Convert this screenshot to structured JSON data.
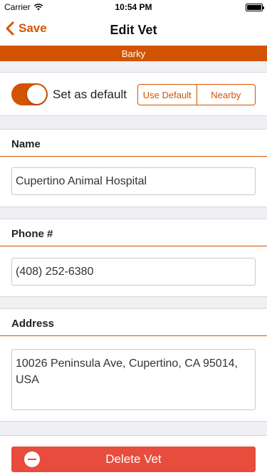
{
  "status_bar": {
    "carrier": "Carrier",
    "time": "10:54 PM"
  },
  "nav": {
    "back_label": "Save",
    "title": "Edit Vet"
  },
  "pet_banner": "Barky",
  "default_row": {
    "label": "Set as default",
    "toggle_on": true,
    "segments": [
      "Use Default",
      "Nearby"
    ]
  },
  "fields": {
    "name": {
      "label": "Name",
      "value": "Cupertino Animal Hospital"
    },
    "phone": {
      "label": "Phone #",
      "value": "(408) 252-6380"
    },
    "address": {
      "label": "Address",
      "value": "10026 Peninsula Ave, Cupertino, CA 95014, USA"
    }
  },
  "delete_label": "Delete Vet",
  "colors": {
    "accent": "#d35400",
    "danger": "#e74c3c",
    "background": "#efeff4"
  }
}
